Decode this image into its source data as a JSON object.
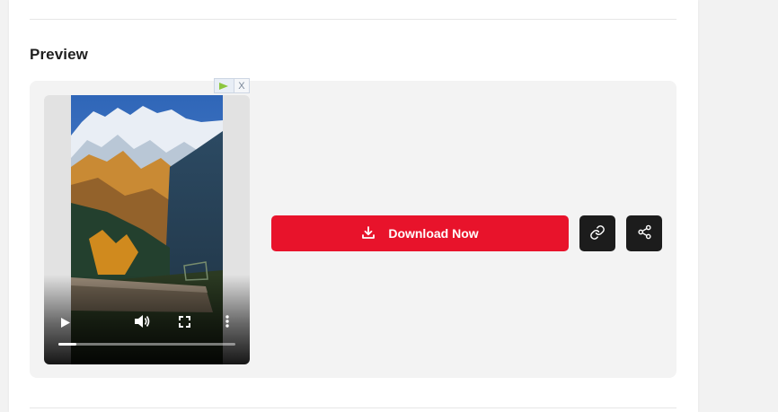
{
  "preview": {
    "title": "Preview",
    "ad_close_label": "X",
    "video": {
      "progress": 0.1,
      "controls": [
        "play-icon",
        "volume-icon",
        "fullscreen-icon",
        "more-options-icon"
      ]
    },
    "download_label": "Download Now",
    "actions": [
      "copy-link-icon",
      "share-icon"
    ],
    "colors": {
      "accent": "#e8132b",
      "icon_button": "#1c1c1c",
      "panel": "#f3f3f3"
    }
  }
}
